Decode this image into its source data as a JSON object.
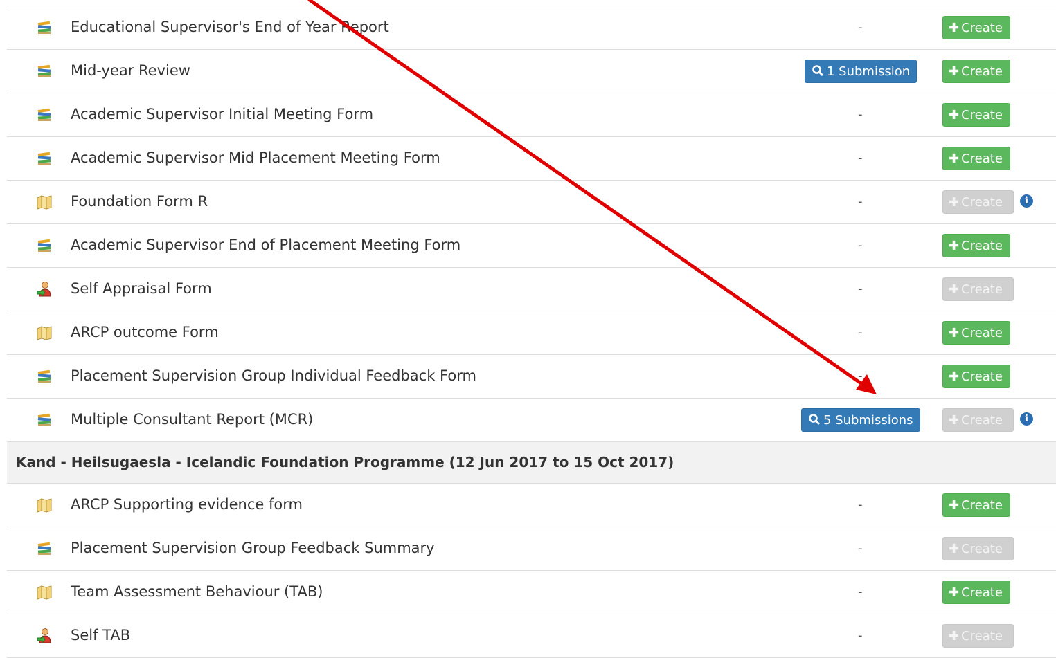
{
  "create_label": "Create",
  "rows_a": [
    {
      "icon": "books-icon",
      "name": "Educational Supervisor's End of Year Report",
      "status": "-",
      "create_enabled": true,
      "info": false
    },
    {
      "icon": "books-icon",
      "name": "Mid-year Review",
      "submission": "1 Submission",
      "create_enabled": true,
      "info": false
    },
    {
      "icon": "books-icon",
      "name": "Academic Supervisor Initial Meeting Form",
      "status": "-",
      "create_enabled": true,
      "info": false
    },
    {
      "icon": "books-icon",
      "name": "Academic Supervisor Mid Placement Meeting Form",
      "status": "-",
      "create_enabled": true,
      "info": false
    },
    {
      "icon": "folder-icon",
      "name": "Foundation Form R",
      "status": "-",
      "create_enabled": false,
      "info": true
    },
    {
      "icon": "books-icon",
      "name": "Academic Supervisor End of Placement Meeting Form",
      "status": "-",
      "create_enabled": true,
      "info": false
    },
    {
      "icon": "person-icon",
      "name": "Self Appraisal Form",
      "status": "-",
      "create_enabled": false,
      "info": false
    },
    {
      "icon": "folder-icon",
      "name": "ARCP outcome Form",
      "status": "-",
      "create_enabled": true,
      "info": false
    },
    {
      "icon": "books-icon",
      "name": "Placement Supervision Group Individual Feedback Form",
      "status": "-",
      "create_enabled": true,
      "info": false
    },
    {
      "icon": "books-icon",
      "name": "Multiple Consultant Report (MCR)",
      "submission": "5 Submissions",
      "create_enabled": false,
      "info": true
    }
  ],
  "section_title": "Kand - Heilsugaesla - Icelandic Foundation Programme (12 Jun 2017 to 15 Oct 2017)",
  "rows_b": [
    {
      "icon": "folder-icon",
      "name": "ARCP Supporting evidence form",
      "status": "-",
      "create_enabled": true,
      "info": false
    },
    {
      "icon": "books-icon",
      "name": "Placement Supervision Group Feedback Summary",
      "status": "-",
      "create_enabled": false,
      "info": false
    },
    {
      "icon": "folder-icon",
      "name": "Team Assessment Behaviour (TAB)",
      "status": "-",
      "create_enabled": true,
      "info": false
    },
    {
      "icon": "person-icon",
      "name": "Self TAB",
      "status": "-",
      "create_enabled": false,
      "info": false
    }
  ],
  "colors": {
    "create_green": "#5cb85c",
    "create_disabled": "#d0d0d0",
    "submission_blue": "#337ab7",
    "info_blue": "#2a6db0",
    "annotation_arrow": "#e00000"
  }
}
